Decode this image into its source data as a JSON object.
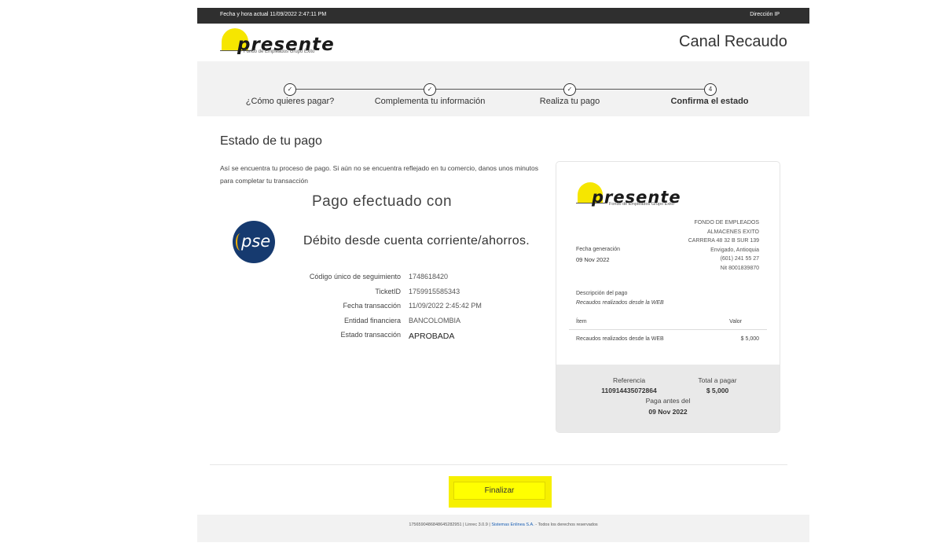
{
  "topbar": {
    "datetime": "Fecha y hora actual 11/09/2022 2:47:11 PM",
    "ip_label": "Dirección IP"
  },
  "brand": {
    "name": "presente",
    "tagline": "Fondo de Empleados Grupo Éxito"
  },
  "header": {
    "title": "Canal Recaudo"
  },
  "steps": [
    {
      "label": "¿Cómo quieres pagar?",
      "state": "done"
    },
    {
      "label": "Complementa tu información",
      "state": "done"
    },
    {
      "label": "Realiza tu pago",
      "state": "done"
    },
    {
      "label": "Confirma el estado",
      "state": "current",
      "number": "4"
    }
  ],
  "main": {
    "title": "Estado de tu pago",
    "description": "Así se encuentra tu proceso de pago. Si aún no se encuentra reflejado en tu comercio, danos unos minutos para completar tu transacción",
    "paid_with_heading": "Pago efectuado con",
    "method_logo": "pse",
    "method": "Débito desde cuenta corriente/ahorros.",
    "details": [
      {
        "label": "Código único de seguimiento",
        "value": "1748618420"
      },
      {
        "label": "TicketID",
        "value": "1759915585343"
      },
      {
        "label": "Fecha transacción",
        "value": "11/09/2022 2:45:42 PM"
      },
      {
        "label": "Entidad financiera",
        "value": "BANCOLOMBIA"
      },
      {
        "label": "Estado transacción",
        "value": "APROBADA"
      }
    ]
  },
  "receipt": {
    "company_lines": [
      "FONDO DE EMPLEADOS",
      "ALMACENES EXITO",
      "CARRERA 48 32 B SUR 139",
      "Envigado, Antioquia",
      "(601) 241 55 27",
      "Nit 8001839870"
    ],
    "gen_label": "Fecha generación",
    "gen_date": "09 Nov 2022",
    "desc_label": "Descripción del pago",
    "desc_value": "Recaudos realizados desde la WEB",
    "col_item": "Ítem",
    "col_value": "Valor",
    "item_name": "Recaudos realizados desde la WEB",
    "item_value": "$ 5,000",
    "ref_label": "Referencia",
    "ref_value": "110914435072864",
    "total_label": "Total a pagar",
    "total_value": "$ 5,000",
    "due_label": "Paga antes del",
    "due_value": "09 Nov 2022"
  },
  "actions": {
    "finish": "Finalizar"
  },
  "footer": {
    "prefix": "17565904868486452829​51 | Linrec 3.0.9 | ",
    "link": "Sistemas Enlinea S.A.",
    "suffix": " - Todos los derechos reservados"
  },
  "colors": {
    "accent": "#ffff00",
    "dark": "#2f2f2f",
    "pse_blue": "#163a6f"
  }
}
